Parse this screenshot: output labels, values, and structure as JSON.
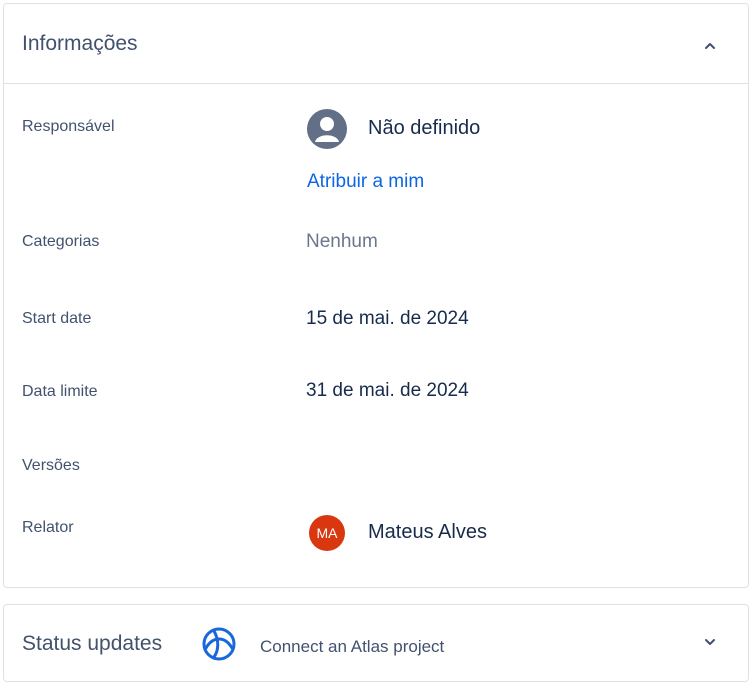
{
  "info_panel": {
    "title": "Informações",
    "assignee": {
      "label": "Responsável",
      "value": "Não definido",
      "assign_link": "Atribuir a mim",
      "avatar_icon": "person-icon"
    },
    "categories": {
      "label": "Categorias",
      "value": "Nenhum"
    },
    "start_date": {
      "label": "Start date",
      "value": "15 de mai. de 2024"
    },
    "due_date": {
      "label": "Data limite",
      "value": "31 de mai. de 2024"
    },
    "versions": {
      "label": "Versões"
    },
    "reporter": {
      "label": "Relator",
      "initials": "MA",
      "name": "Mateus Alves",
      "avatar_color": "#d9370f"
    }
  },
  "status_panel": {
    "title": "Status updates",
    "connect_text": "Connect an Atlas project",
    "icon": "atlas-icon",
    "icon_color": "#1868db"
  }
}
